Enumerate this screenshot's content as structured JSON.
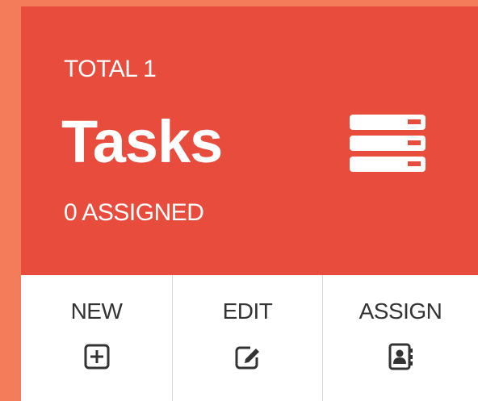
{
  "widget": {
    "total_text": "TOTAL 1",
    "title": "Tasks",
    "assigned_text": "0 ASSIGNED",
    "icon": "tasks-stack-icon"
  },
  "actions": [
    {
      "label": "NEW",
      "icon": "plus-square-icon"
    },
    {
      "label": "EDIT",
      "icon": "edit-icon"
    },
    {
      "label": "ASSIGN",
      "icon": "address-book-icon"
    }
  ],
  "colors": {
    "page_background": "#f47c5a",
    "card_header": "#e84c3d",
    "card_body": "#ffffff",
    "action_text": "#333333"
  }
}
